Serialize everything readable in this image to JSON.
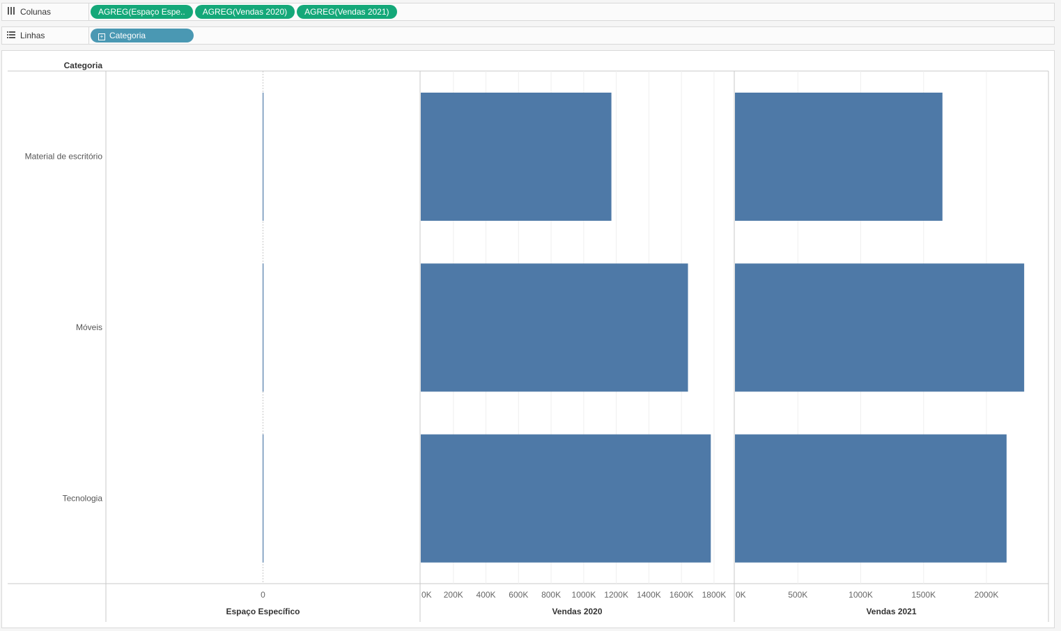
{
  "shelves": {
    "columns": {
      "label": "Colunas",
      "icon": "columns-icon",
      "pills": [
        "AGREG(Espaço Espe..",
        "AGREG(Vendas 2020)",
        "AGREG(Vendas 2021)"
      ]
    },
    "rows": {
      "label": "Linhas",
      "icon": "rows-icon",
      "pills": [
        "Categoria"
      ]
    }
  },
  "colors": {
    "bar": "#4e79a7",
    "pill_measure": "#14a879",
    "pill_dimension": "#4a98b3"
  },
  "chart_data": {
    "type": "bar",
    "orientation": "horizontal",
    "row_header": "Categoria",
    "categories": [
      "Material de escritório",
      "Móveis",
      "Tecnologia"
    ],
    "panes": [
      {
        "name": "Espaço Específico",
        "values": [
          0,
          0,
          0
        ],
        "xlim": [
          -1,
          1
        ],
        "ticks": [
          0
        ],
        "tick_labels": [
          "0"
        ]
      },
      {
        "name": "Vendas 2020",
        "values": [
          1170000,
          1640000,
          1780000
        ],
        "xlim": [
          0,
          1860000
        ],
        "ticks": [
          0,
          200000,
          400000,
          600000,
          800000,
          1000000,
          1200000,
          1400000,
          1600000,
          1800000
        ],
        "tick_labels": [
          "0K",
          "200K",
          "400K",
          "600K",
          "800K",
          "1000K",
          "1200K",
          "1400K",
          "1600K",
          "1800K"
        ]
      },
      {
        "name": "Vendas 2021",
        "values": [
          1650000,
          2300000,
          2160000
        ],
        "xlim": [
          0,
          2410000
        ],
        "ticks": [
          0,
          500000,
          1000000,
          1500000,
          2000000
        ],
        "tick_labels": [
          "0K",
          "500K",
          "1000K",
          "1500K",
          "2000K"
        ]
      }
    ]
  }
}
